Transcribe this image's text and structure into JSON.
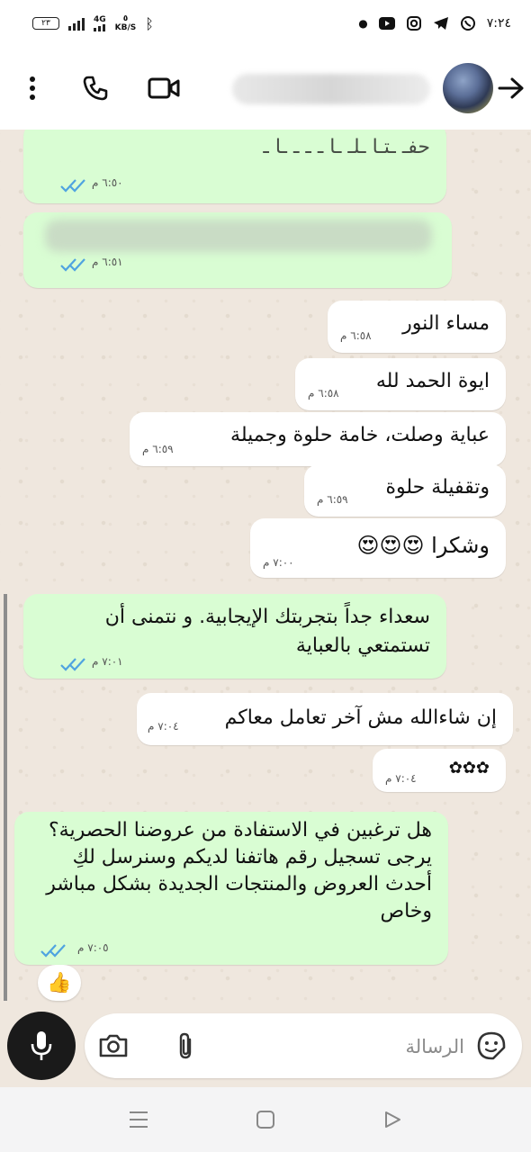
{
  "status_bar": {
    "battery": "٢٣",
    "network": "4G",
    "speed_value": "٥",
    "speed_unit": "KB/S",
    "time": "٧:٢٤"
  },
  "header": {
    "contact_name": "",
    "icons": [
      "more-icon",
      "phone-icon",
      "video-icon",
      "back-arrow-icon"
    ]
  },
  "messages": [
    {
      "dir": "out",
      "text": "حفـ ـتـا ـلـ ـا ـ ـ ـ ـا ـ",
      "time": "٦:٥٠ م",
      "ticks": "read"
    },
    {
      "dir": "out",
      "text": "",
      "time": "٦:٥١ م",
      "ticks": "read"
    },
    {
      "dir": "in",
      "text": "مساء النور",
      "time": "٦:٥٨ م"
    },
    {
      "dir": "in",
      "text": "ايوة الحمد لله",
      "time": "٦:٥٨ م"
    },
    {
      "dir": "in",
      "text": "عباية وصلت، خامة حلوة وجميلة",
      "time": "٦:٥٩ م"
    },
    {
      "dir": "in",
      "text": "وتقفيلة حلوة",
      "time": "٦:٥٩ م"
    },
    {
      "dir": "in",
      "text": "وشكرا 😍😍😍",
      "time": "٧:٠٠ م"
    },
    {
      "dir": "out",
      "text": "سعداء جداً بتجربتك الإيجابية. و نتمنى  أن تستمتعي بالعباية",
      "time": "٧:٠١ م",
      "ticks": "read"
    },
    {
      "dir": "in",
      "text": "إن شاءالله مش آخر تعامل معاكم",
      "time": "٧:٠٤ م"
    },
    {
      "dir": "in",
      "text": "✿✿✿",
      "time": "٧:٠٤ م"
    },
    {
      "dir": "out",
      "text": "هل ترغبين في الاستفادة من عروضنا الحصرية؟ يرجى تسجيل  رقم هاتفنا  لديكم وسنرسل لكِ أحدث العروض والمنتجات الجديدة بشكل مباشر وخاص",
      "time": "٧:٠٥ م",
      "ticks": "read"
    }
  ],
  "reaction": "👍",
  "input": {
    "placeholder": "الرسالة"
  },
  "colors": {
    "outgoing_bubble": "#d9fdd3",
    "incoming_bubble": "#ffffff",
    "read_ticks": "#4fa3e0",
    "chat_background": "#efe7de"
  }
}
